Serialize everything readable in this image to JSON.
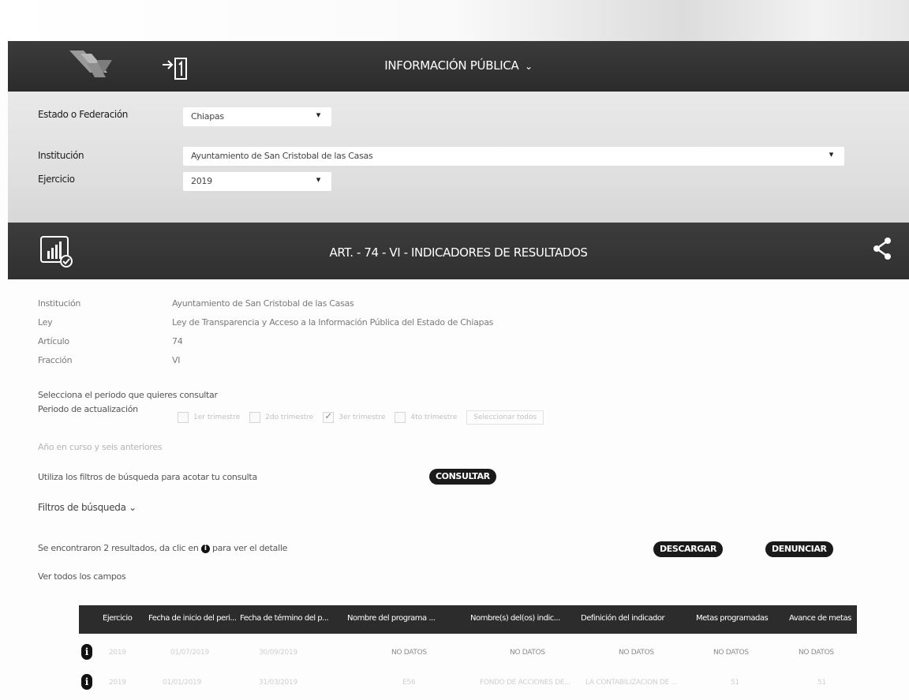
{
  "header": {
    "title": "INFORMACIÓN PÚBLICA",
    "chevron": "⌄",
    "logo_icon": "logo-mark",
    "login_icon": "login-icon"
  },
  "filters": {
    "estado_label": "Estado o Federación",
    "estado_value": "Chiapas",
    "institucion_label": "Institución",
    "institucion_value": "Ayuntamiento de San Cristobal de las Casas",
    "ejercicio_label": "Ejercicio",
    "ejercicio_value": "2019",
    "caret": "▾"
  },
  "section": {
    "title": "ART. - 74 - VI - INDICADORES DE RESULTADOS",
    "icon": "chart-check-icon",
    "share_icon": "share-icon"
  },
  "meta": {
    "institucion_label": "Institución",
    "institucion_value": "Ayuntamiento de San Cristobal de las Casas",
    "ley_label": "Ley",
    "ley_value": "Ley de Transparencia y Acceso a la Información Pública del Estado de Chiapas",
    "articulo_label": "Artículo",
    "articulo_value": "74",
    "fraccion_label": "Fracción",
    "fraccion_value": "VI"
  },
  "period": {
    "prompt": "Selecciona el periodo que quieres consultar",
    "label": "Periodo de actualización",
    "options": [
      "1er trimestre",
      "2do trimestre",
      "3er trimestre",
      "4to trimestre"
    ],
    "checked_index": 2,
    "select_all": "Seleccionar todos",
    "year_note": "Año en curso y seis anteriores"
  },
  "search": {
    "hint": "Utiliza los filtros de búsqueda para acotar tu consulta",
    "consult_button": "CONSULTAR",
    "filters_toggle": "Filtros de búsqueda",
    "filters_chevron": "⌄"
  },
  "results": {
    "prefix": "Se encontraron 2 resultados, da clic en",
    "suffix": "para ver el detalle",
    "info_glyph": "i",
    "download_button": "DESCARGAR",
    "report_button": "DENUNCIAR",
    "view_all": "Ver todos los campos"
  },
  "table": {
    "columns": [
      "Ejercicio",
      "Fecha de inicio del peri...",
      "Fecha de término del p...",
      "Nombre del programa ...",
      "Nombre(s) del(os) indic...",
      "Definición del indicador",
      "Metas programadas",
      "Avance de metas"
    ],
    "rows": [
      [
        "2019",
        "01/07/2019",
        "30/09/2019",
        "NO DATOS",
        "NO DATOS",
        "NO DATOS",
        "NO DATOS",
        "NO DATOS"
      ],
      [
        "2019",
        "01/01/2019",
        "31/03/2019",
        "E56",
        "FONDO DE ACCIONES DE...",
        "LA CONTABILIZACION DE ...",
        "51",
        "51"
      ]
    ]
  }
}
